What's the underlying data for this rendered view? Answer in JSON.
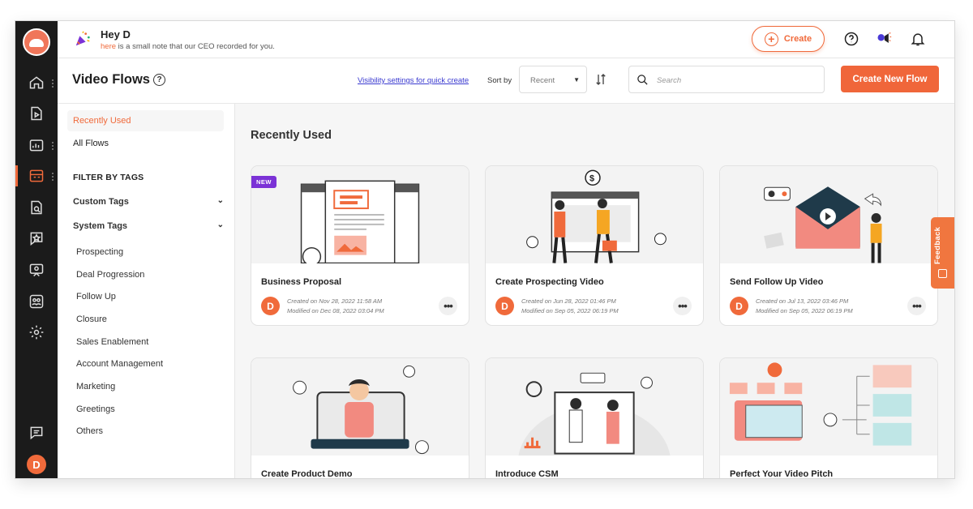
{
  "greeting": {
    "title": "Hey D",
    "link": "here",
    "note": "is a small note that our CEO recorded for you."
  },
  "topbar": {
    "create_label": "Create"
  },
  "header": {
    "title": "Video Flows",
    "visibility_link": "Visibility settings for quick create",
    "sort_label": "Sort by",
    "sort_value": "Recent",
    "search_placeholder": "Search",
    "create_flow_label": "Create New Flow"
  },
  "sidebar": {
    "recent": "Recently Used",
    "all": "All Flows",
    "filter_title": "FILTER BY TAGS",
    "custom_tags": "Custom Tags",
    "system_tags": "System Tags",
    "tags": [
      "Prospecting",
      "Deal Progression",
      "Follow Up",
      "Closure",
      "Sales Enablement",
      "Account Management",
      "Marketing",
      "Greetings",
      "Others"
    ]
  },
  "main": {
    "section_title": "Recently Used",
    "cards": [
      {
        "title": "Business Proposal",
        "badge": "NEW",
        "created": "Created on Nov 28, 2022 11:58 AM",
        "modified": "Modified on Dec 08, 2022 03:04 PM",
        "avatar": "D"
      },
      {
        "title": "Create Prospecting Video",
        "created": "Created on Jun 28, 2022 01:46 PM",
        "modified": "Modified on Sep 05, 2022 06:19 PM",
        "avatar": "D"
      },
      {
        "title": "Send Follow Up Video",
        "created": "Created on Jul 13, 2022 03:46 PM",
        "modified": "Modified on Sep 05, 2022 06:19 PM",
        "avatar": "D"
      },
      {
        "title": "Create Product Demo"
      },
      {
        "title": "Introduce CSM"
      },
      {
        "title": "Perfect Your Video Pitch"
      }
    ]
  },
  "user": {
    "avatar": "D"
  },
  "feedback": {
    "label": "Feedback"
  },
  "colors": {
    "accent": "#f06a3b",
    "rail": "#1b1b1b",
    "badge": "#7b32d6"
  }
}
